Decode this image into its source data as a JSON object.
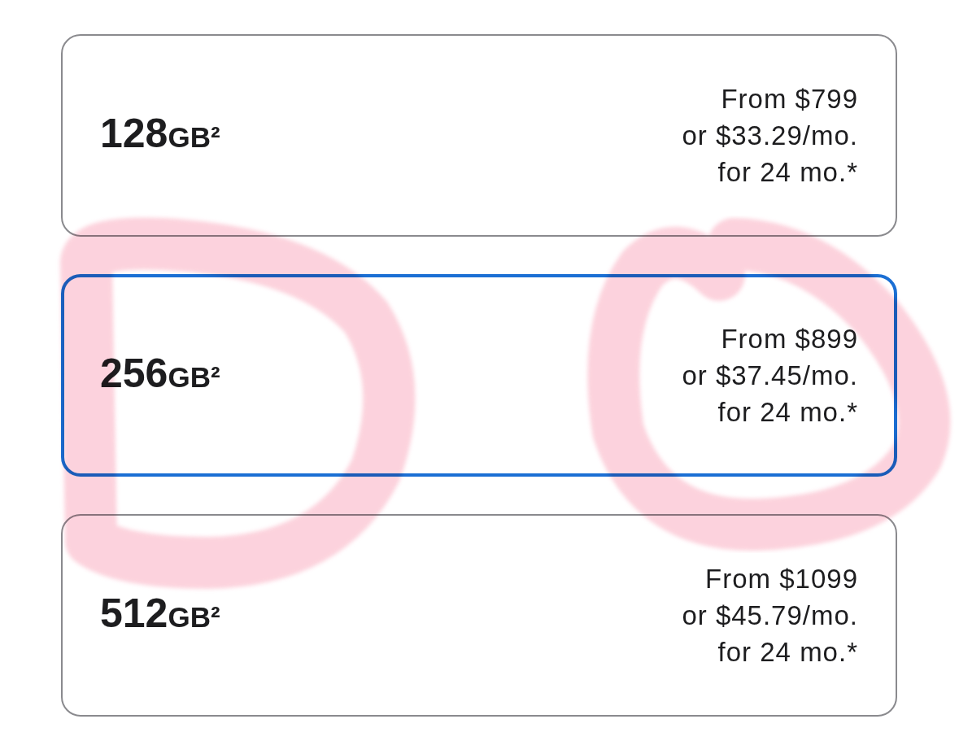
{
  "options": [
    {
      "capacity": "128",
      "unit": "GB²",
      "price_lines": [
        "From $799",
        "or $33.29/mo.",
        "for 24 mo.*"
      ],
      "selected": false,
      "capacity_circled": false,
      "price_circled": false
    },
    {
      "capacity": "256",
      "unit": "GB²",
      "price_lines": [
        "From $899",
        "or $37.45/mo.",
        "for 24 mo.*"
      ],
      "selected": true,
      "capacity_circled": true,
      "price_circled": true
    },
    {
      "capacity": "512",
      "unit": "GB²",
      "price_lines": [
        "From $1099",
        "or $45.79/mo.",
        "for 24 mo.*"
      ],
      "selected": false,
      "capacity_circled": false,
      "price_circled": false
    }
  ]
}
